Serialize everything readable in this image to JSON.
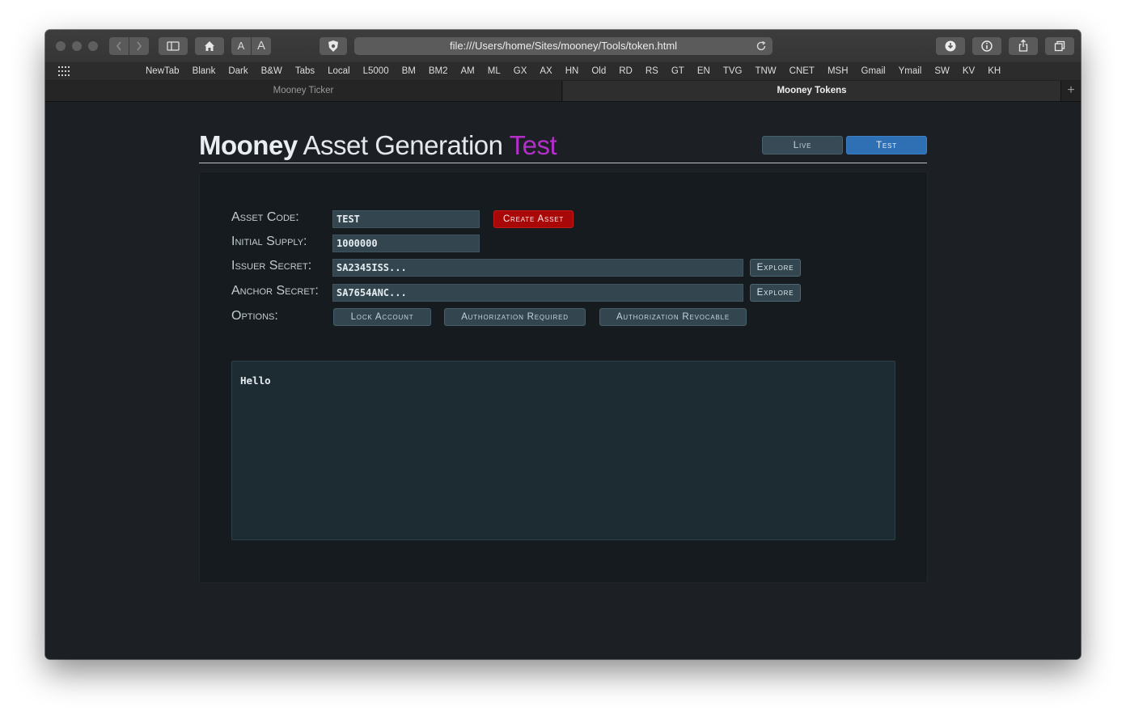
{
  "browser": {
    "url": "file:///Users/home/Sites/mooney/Tools/token.html",
    "text_size_small": "A",
    "text_size_large": "A",
    "bookmarks": [
      "NewTab",
      "Blank",
      "Dark",
      "B&W",
      "Tabs",
      "Local",
      "L5000",
      "BM",
      "BM2",
      "AM",
      "ML",
      "GX",
      "AX",
      "HN",
      "Old",
      "RD",
      "RS",
      "GT",
      "EN",
      "TVG",
      "TNW",
      "CNET",
      "MSH",
      "Gmail",
      "Ymail",
      "SW",
      "KV",
      "KH"
    ],
    "tabs": [
      {
        "title": "Mooney Ticker",
        "active": false
      },
      {
        "title": "Mooney Tokens",
        "active": true
      }
    ],
    "new_tab_symbol": "+"
  },
  "page": {
    "title_brand": "Mooney",
    "title_main": "Asset Generation",
    "title_env": "Test",
    "env_buttons": {
      "live": "Live",
      "test": "Test"
    },
    "form": {
      "asset_code_label": "Asset Code:",
      "asset_code_value": "TEST",
      "initial_supply_label": "Initial Supply:",
      "initial_supply_value": "1000000",
      "issuer_secret_label": "Issuer Secret:",
      "issuer_secret_value": "SA2345ISS...",
      "anchor_secret_label": "Anchor Secret:",
      "anchor_secret_value": "SA7654ANC...",
      "options_label": "Options:",
      "create_button": "Create Asset",
      "explore_button": "Explore",
      "options": [
        "Lock Account",
        "Authorization Required",
        "Authorization Revocable"
      ]
    },
    "output_text": "Hello"
  },
  "colors": {
    "accent_test": "#b42ec9",
    "create_button": "#a80808",
    "test_button": "#2f6fb4",
    "page_background": "#1c2024"
  }
}
